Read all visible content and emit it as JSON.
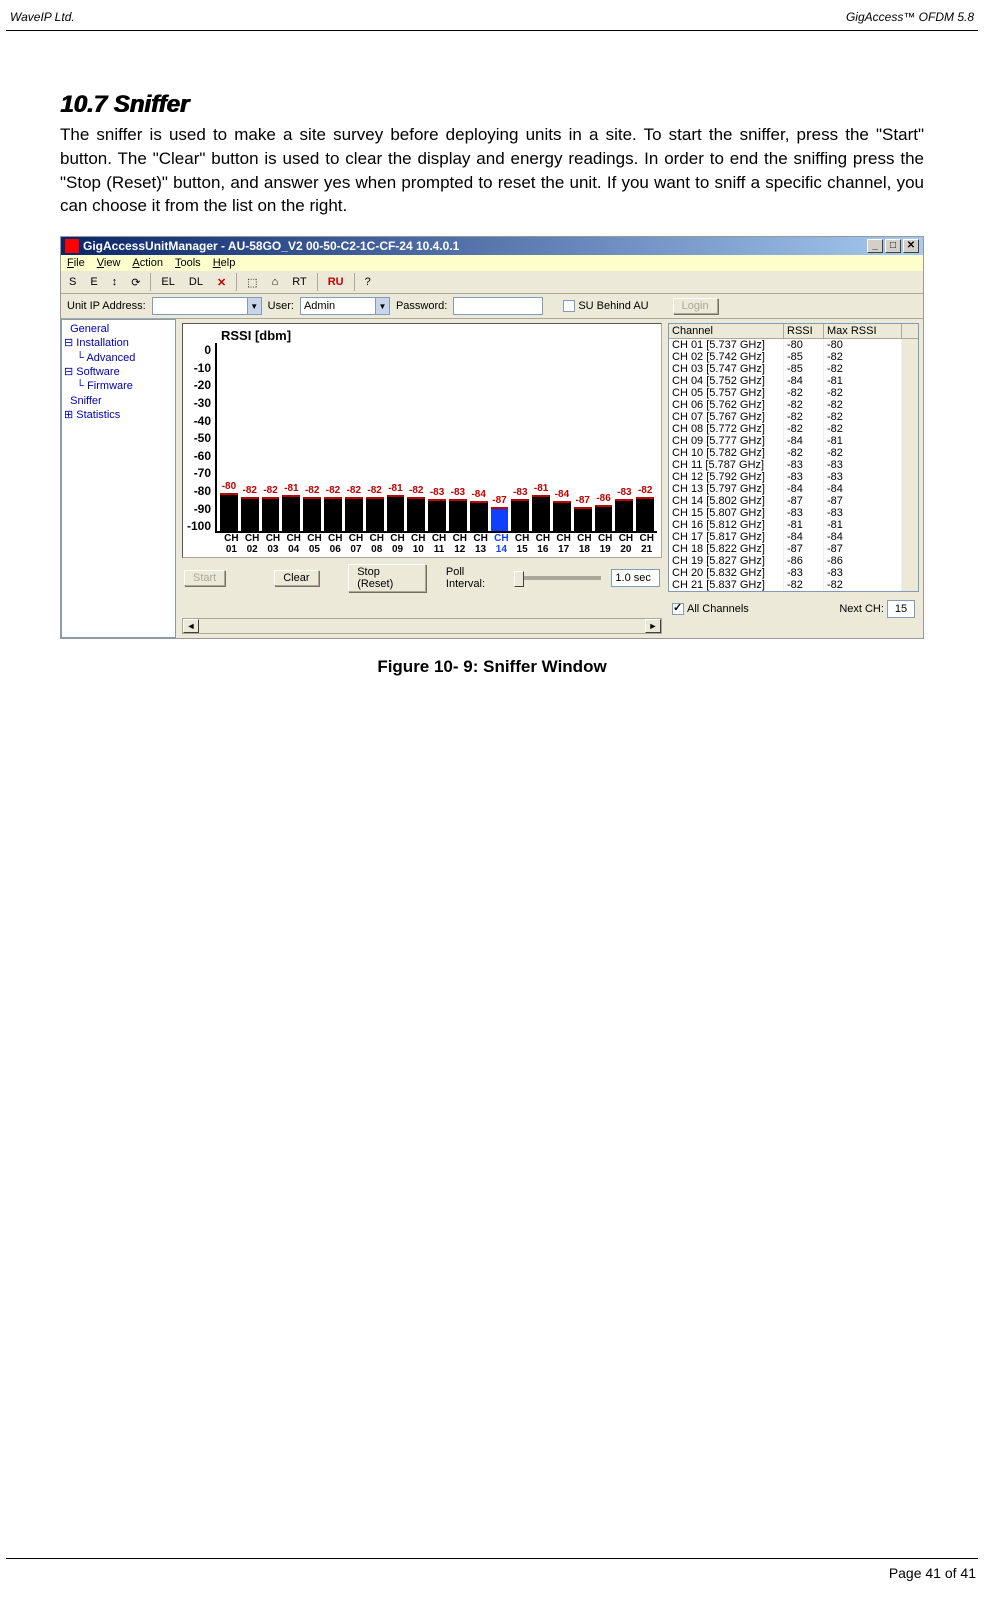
{
  "header": {
    "left": "WaveIP Ltd.",
    "right": "GigAccess™ OFDM 5.8"
  },
  "section": {
    "number_title": "10.7 Sniffer"
  },
  "paragraph": "The sniffer is used to make a site survey before deploying units in a site. To start the sniffer, press the \"Start\" button. The \"Clear\" button is used to clear the display and energy readings. In order to end the sniffing press the \"Stop (Reset)\" button, and answer yes when prompted to reset the unit. If you want to sniff a specific channel, you can choose it from the list on the right.",
  "figure_caption": "Figure 10- 9: Sniffer Window",
  "footer": "Page 41 of 41",
  "app": {
    "title": "GigAccessUnitManager - AU-58GO_V2 00-50-C2-1C-CF-24  10.4.0.1",
    "winbtns": {
      "min": "_",
      "max": "□",
      "close": "✕"
    },
    "menus": [
      "File",
      "View",
      "Action",
      "Tools",
      "Help"
    ],
    "toolbar": {
      "items": [
        "S",
        "E",
        "↕",
        "⟳",
        "EL",
        "DL",
        "✕",
        "",
        "⬚",
        "⌂",
        "RT",
        "RU",
        "",
        "?"
      ]
    },
    "conn": {
      "ip_label": "Unit IP Address:",
      "user_label": "User:",
      "user_value": "Admin",
      "pass_label": "Password:",
      "su_label": "SU Behind AU",
      "login": "Login"
    },
    "tree": [
      "  General",
      "⊟ Installation",
      "    └ Advanced",
      "⊟ Software",
      "    └ Firmware",
      "  Sniffer",
      "⊞ Statistics"
    ],
    "buttons": {
      "start": "Start",
      "clear": "Clear",
      "stop": "Stop (Reset)",
      "poll_label": "Poll Interval:",
      "poll_value": "1.0 sec"
    },
    "right": {
      "headers": {
        "c1": "Channel",
        "c2": "RSSI",
        "c3": "Max RSSI"
      },
      "allch": "All Channels",
      "nextch_label": "Next CH:",
      "nextch_value": "15"
    }
  },
  "chart_data": {
    "type": "bar",
    "title": "RSSI [dbm]",
    "ylabel": "",
    "ylim": [
      -100,
      0
    ],
    "yticks": [
      0,
      -10,
      -20,
      -30,
      -40,
      -50,
      -60,
      -70,
      -80,
      -90,
      -100
    ],
    "categories": [
      "CH 01",
      "CH 02",
      "CH 03",
      "CH 04",
      "CH 05",
      "CH 06",
      "CH 07",
      "CH 08",
      "CH 09",
      "CH 10",
      "CH 11",
      "CH 12",
      "CH 13",
      "CH 14",
      "CH 15",
      "CH 16",
      "CH 17",
      "CH 18",
      "CH 19",
      "CH 20",
      "CH 21"
    ],
    "values": [
      -80,
      -82,
      -82,
      -81,
      -82,
      -82,
      -82,
      -82,
      -81,
      -82,
      -83,
      -83,
      -84,
      -87,
      -83,
      -81,
      -84,
      -87,
      -86,
      -83,
      -82
    ],
    "selected_index": 13,
    "table": [
      {
        "ch": "CH 01 [5.737 GHz]",
        "rssi": -80,
        "max": -80
      },
      {
        "ch": "CH 02 [5.742 GHz]",
        "rssi": -85,
        "max": -82
      },
      {
        "ch": "CH 03 [5.747 GHz]",
        "rssi": -85,
        "max": -82
      },
      {
        "ch": "CH 04 [5.752 GHz]",
        "rssi": -84,
        "max": -81
      },
      {
        "ch": "CH 05 [5.757 GHz]",
        "rssi": -82,
        "max": -82
      },
      {
        "ch": "CH 06 [5.762 GHz]",
        "rssi": -82,
        "max": -82
      },
      {
        "ch": "CH 07 [5.767 GHz]",
        "rssi": -82,
        "max": -82
      },
      {
        "ch": "CH 08 [5.772 GHz]",
        "rssi": -82,
        "max": -82
      },
      {
        "ch": "CH 09 [5.777 GHz]",
        "rssi": -84,
        "max": -81
      },
      {
        "ch": "CH 10 [5.782 GHz]",
        "rssi": -82,
        "max": -82
      },
      {
        "ch": "CH 11 [5.787 GHz]",
        "rssi": -83,
        "max": -83
      },
      {
        "ch": "CH 12 [5.792 GHz]",
        "rssi": -83,
        "max": -83
      },
      {
        "ch": "CH 13 [5.797 GHz]",
        "rssi": -84,
        "max": -84
      },
      {
        "ch": "CH 14 [5.802 GHz]",
        "rssi": -87,
        "max": -87
      },
      {
        "ch": "CH 15 [5.807 GHz]",
        "rssi": -83,
        "max": -83
      },
      {
        "ch": "CH 16 [5.812 GHz]",
        "rssi": -81,
        "max": -81
      },
      {
        "ch": "CH 17 [5.817 GHz]",
        "rssi": -84,
        "max": -84
      },
      {
        "ch": "CH 18 [5.822 GHz]",
        "rssi": -87,
        "max": -87
      },
      {
        "ch": "CH 19 [5.827 GHz]",
        "rssi": -86,
        "max": -86
      },
      {
        "ch": "CH 20 [5.832 GHz]",
        "rssi": -83,
        "max": -83
      },
      {
        "ch": "CH 21 [5.837 GHz]",
        "rssi": -82,
        "max": -82
      }
    ]
  }
}
